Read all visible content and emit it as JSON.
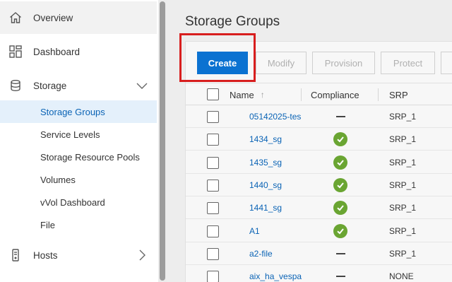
{
  "sidebar": {
    "items": [
      {
        "label": "Overview",
        "icon": "home-icon"
      },
      {
        "label": "Dashboard",
        "icon": "dashboard-icon"
      },
      {
        "label": "Storage",
        "icon": "storage-icon",
        "expanded": true
      },
      {
        "label": "Hosts",
        "icon": "hosts-icon",
        "expanded": false
      }
    ],
    "storage_children": [
      {
        "label": "Storage Groups",
        "active": true
      },
      {
        "label": "Service Levels"
      },
      {
        "label": "Storage Resource Pools"
      },
      {
        "label": "Volumes"
      },
      {
        "label": "vVol Dashboard"
      },
      {
        "label": "File"
      }
    ]
  },
  "page": {
    "title": "Storage Groups"
  },
  "toolbar": {
    "create": "Create",
    "modify": "Modify",
    "provision": "Provision",
    "protect": "Protect"
  },
  "table": {
    "headers": {
      "name": "Name",
      "sort_indicator": "↑",
      "compliance": "Compliance",
      "srp": "SRP"
    },
    "rows": [
      {
        "name": "05142025-tes",
        "compliance": "none",
        "srp": "SRP_1"
      },
      {
        "name": "1434_sg",
        "compliance": "ok",
        "srp": "SRP_1"
      },
      {
        "name": "1435_sg",
        "compliance": "ok",
        "srp": "SRP_1"
      },
      {
        "name": "1440_sg",
        "compliance": "ok",
        "srp": "SRP_1"
      },
      {
        "name": "1441_sg",
        "compliance": "ok",
        "srp": "SRP_1"
      },
      {
        "name": "A1",
        "compliance": "ok",
        "srp": "SRP_1"
      },
      {
        "name": "a2-file",
        "compliance": "none",
        "srp": "SRP_1"
      },
      {
        "name": "aix_ha_vespa",
        "compliance": "none",
        "srp": "NONE"
      }
    ]
  },
  "colors": {
    "primary": "#0b72d1",
    "link": "#0a63b5",
    "compliance_ok": "#6aa532",
    "highlight": "#d81e1e",
    "active_nav_bg": "#e4f0fb"
  }
}
